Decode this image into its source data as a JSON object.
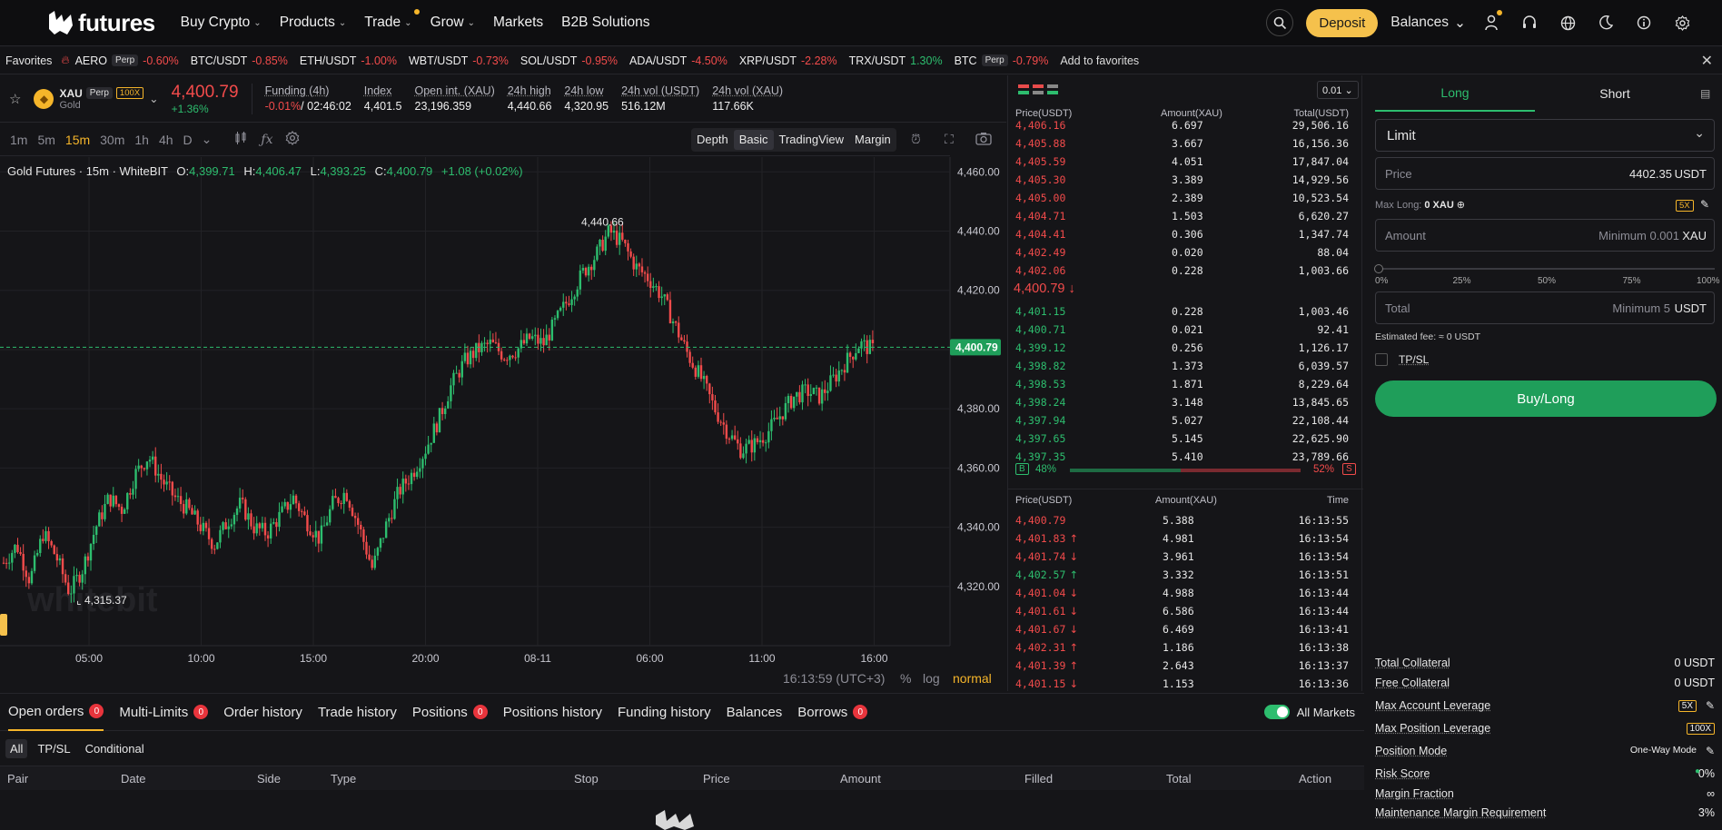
{
  "nav": {
    "logo_text": "futures",
    "menu": [
      {
        "label": "Buy Crypto",
        "chevron": true
      },
      {
        "label": "Products",
        "chevron": true
      },
      {
        "label": "Trade",
        "chevron": true
      },
      {
        "label": "Grow",
        "chevron": true
      },
      {
        "label": "Markets",
        "chevron": false
      },
      {
        "label": "B2B Solutions",
        "chevron": false
      }
    ],
    "deposit": "Deposit",
    "balances": "Balances"
  },
  "favorites": {
    "label": "Favorites",
    "items": [
      {
        "symbol": "AERO",
        "perp": "Perp",
        "change": "-0.60%",
        "up": false
      },
      {
        "symbol": "BTC/USDT",
        "perp": "",
        "change": "-0.85%",
        "up": false
      },
      {
        "symbol": "ETH/USDT",
        "perp": "",
        "change": "-1.00%",
        "up": false
      },
      {
        "symbol": "WBT/USDT",
        "perp": "",
        "change": "-0.73%",
        "up": false
      },
      {
        "symbol": "SOL/USDT",
        "perp": "",
        "change": "-0.95%",
        "up": false
      },
      {
        "symbol": "ADA/USDT",
        "perp": "",
        "change": "-4.50%",
        "up": false
      },
      {
        "symbol": "XRP/USDT",
        "perp": "",
        "change": "-2.28%",
        "up": false
      },
      {
        "symbol": "TRX/USDT",
        "perp": "",
        "change": "1.30%",
        "up": true
      },
      {
        "symbol": "BTC",
        "perp": "Perp",
        "change": "-0.79%",
        "up": false
      }
    ],
    "add": "Add to favorites"
  },
  "ticker": {
    "symbol": "XAU",
    "perp": "Perp",
    "leverage": "100X",
    "name": "Gold",
    "price": "4,400.79",
    "change": "+1.36%",
    "stats": [
      {
        "label": "Funding (4h)",
        "value": "-0.01%",
        "value2": "/ 02:46:02"
      },
      {
        "label": "Index",
        "value": "4,401.5"
      },
      {
        "label": "Open int. (XAU)",
        "value": "23,196.359"
      },
      {
        "label": "24h high",
        "value": "4,440.66"
      },
      {
        "label": "24h low",
        "value": "4,320.95"
      },
      {
        "label": "24h vol (USDT)",
        "value": "516.12M"
      },
      {
        "label": "24h vol (XAU)",
        "value": "117.66K"
      }
    ]
  },
  "chart_tools": {
    "timeframes": [
      "1m",
      "5m",
      "15m",
      "30m",
      "1h",
      "4h",
      "D"
    ],
    "active": "15m",
    "views": [
      "Depth",
      "Basic",
      "TradingView",
      "Margin"
    ],
    "active_view": "Basic"
  },
  "chart_data": {
    "type": "candlestick",
    "legend": {
      "title": "Gold Futures · 15m · WhiteBIT",
      "o": "4,399.71",
      "h": "4,406.47",
      "l": "4,393.25",
      "c": "4,400.79",
      "chg": "+1.08 (+0.02%)"
    },
    "y_ticks": [
      "4,460.00",
      "4,440.00",
      "4,420.00",
      "4,400.00",
      "4,380.00",
      "4,360.00",
      "4,340.00",
      "4,320.00"
    ],
    "y_tick_values": [
      4460,
      4440,
      4420,
      4400,
      4380,
      4360,
      4340,
      4320
    ],
    "x_ticks": [
      "05:00",
      "10:00",
      "15:00",
      "20:00",
      "08-11",
      "06:00",
      "11:00",
      "16:00"
    ],
    "last_price": "4,400.79",
    "last_value": 4400.79,
    "high_label": "4,440.66",
    "high_value": 4440.66,
    "low_label": "4,315.37",
    "low_value": 4315.37,
    "ylim": [
      4300,
      4465
    ],
    "watermark": "whitebit",
    "path": [
      4328,
      4334,
      4322,
      4338,
      4330,
      4318,
      4326,
      4340,
      4350,
      4346,
      4358,
      4364,
      4356,
      4350,
      4346,
      4340,
      4334,
      4342,
      4348,
      4340,
      4338,
      4344,
      4350,
      4342,
      4336,
      4348,
      4352,
      4340,
      4326,
      4340,
      4352,
      4358,
      4366,
      4376,
      4388,
      4396,
      4400,
      4402,
      4398,
      4400,
      4404,
      4402,
      4410,
      4418,
      4426,
      4432,
      4440,
      4436,
      4428,
      4424,
      4418,
      4408,
      4398,
      4390,
      4380,
      4372,
      4366,
      4368,
      4372,
      4378,
      4384,
      4386,
      4384,
      4390,
      4396,
      4402,
      4400
    ]
  },
  "chart_footer": {
    "time": "16:13:59 (UTC+3)",
    "pct": "%",
    "log": "log",
    "normal": "normal"
  },
  "orderbook": {
    "step": "0.01",
    "head": [
      "Price(USDT)",
      "Amount(XAU)",
      "Total(USDT)"
    ],
    "asks": [
      [
        "4,406.16",
        "6.697",
        "29,506.16"
      ],
      [
        "4,405.88",
        "3.667",
        "16,156.36"
      ],
      [
        "4,405.59",
        "4.051",
        "17,847.04"
      ],
      [
        "4,405.30",
        "3.389",
        "14,929.56"
      ],
      [
        "4,405.00",
        "2.389",
        "10,523.54"
      ],
      [
        "4,404.71",
        "1.503",
        "6,620.27"
      ],
      [
        "4,404.41",
        "0.306",
        "1,347.74"
      ],
      [
        "4,402.49",
        "0.020",
        "88.04"
      ],
      [
        "4,402.06",
        "0.228",
        "1,003.66"
      ]
    ],
    "mid": "4,400.79 ↓",
    "bids": [
      [
        "4,401.15",
        "0.228",
        "1,003.46"
      ],
      [
        "4,400.71",
        "0.021",
        "92.41"
      ],
      [
        "4,399.12",
        "0.256",
        "1,126.17"
      ],
      [
        "4,398.82",
        "1.373",
        "6,039.57"
      ],
      [
        "4,398.53",
        "1.871",
        "8,229.64"
      ],
      [
        "4,398.24",
        "3.148",
        "13,845.65"
      ],
      [
        "4,397.94",
        "5.027",
        "22,108.44"
      ],
      [
        "4,397.65",
        "5.145",
        "22,625.90"
      ],
      [
        "4,397.35",
        "5.410",
        "23,789.66"
      ]
    ],
    "buy_pct": "48%",
    "sell_pct": "52%",
    "buy_fraction": 0.48,
    "b": "B",
    "s": "S"
  },
  "trades": {
    "head": [
      "Price(USDT)",
      "Amount(XAU)",
      "Time"
    ],
    "rows": [
      [
        "4,400.79",
        "",
        "5.388",
        "16:13:55",
        false
      ],
      [
        "4,401.83",
        "↑",
        "4.981",
        "16:13:54",
        false
      ],
      [
        "4,401.74",
        "↓",
        "3.961",
        "16:13:54",
        false
      ],
      [
        "4,402.57",
        "↑",
        "3.332",
        "16:13:51",
        true
      ],
      [
        "4,401.04",
        "↓",
        "4.988",
        "16:13:44",
        false
      ],
      [
        "4,401.61",
        "↓",
        "6.586",
        "16:13:44",
        false
      ],
      [
        "4,401.67",
        "↓",
        "6.469",
        "16:13:41",
        false
      ],
      [
        "4,402.31",
        "↑",
        "1.186",
        "16:13:38",
        false
      ],
      [
        "4,401.39",
        "↑",
        "2.643",
        "16:13:37",
        false
      ],
      [
        "4,401.15",
        "↓",
        "1.153",
        "16:13:36",
        false
      ]
    ]
  },
  "bottom_tabs": [
    {
      "label": "Open orders",
      "badge": "0",
      "active": true
    },
    {
      "label": "Multi-Limits",
      "badge": "0"
    },
    {
      "label": "Order history",
      "badge": ""
    },
    {
      "label": "Trade history",
      "badge": ""
    },
    {
      "label": "Positions",
      "badge": "0"
    },
    {
      "label": "Positions history",
      "badge": ""
    },
    {
      "label": "Funding history",
      "badge": ""
    },
    {
      "label": "Balances",
      "badge": ""
    },
    {
      "label": "Borrows",
      "badge": "0"
    }
  ],
  "all_markets": "All Markets",
  "sub_tabs": [
    "All",
    "TP/SL",
    "Conditional"
  ],
  "columns": [
    "Pair",
    "Date",
    "Side",
    "Type",
    "Stop",
    "Price",
    "Amount",
    "Filled",
    "Total",
    "Action"
  ],
  "order_form": {
    "long": "Long",
    "short": "Short",
    "type": "Limit",
    "price_label": "Price",
    "price": "4402.35",
    "usdt": "USDT",
    "max_long": "Max Long:",
    "max_long_val": "0 XAU",
    "lev": "5X",
    "amount_label": "Amount",
    "amount_placeholder": "Minimum 0.001",
    "xau": "XAU",
    "slider": [
      "0%",
      "25%",
      "50%",
      "75%",
      "100%"
    ],
    "total_label": "Total",
    "total_placeholder": "Minimum 5",
    "fee": "Estimated fee: ≈ 0 USDT",
    "tpsl": "TP/SL",
    "submit": "Buy/Long"
  },
  "account": [
    {
      "label": "Total Collateral",
      "value": "0 USDT"
    },
    {
      "label": "Free Collateral",
      "value": "0 USDT"
    },
    {
      "label": "Max Account Leverage",
      "value": "5X"
    },
    {
      "label": "Max Position Leverage",
      "value": "100X"
    },
    {
      "label": "Position Mode",
      "value": "One-Way Mode"
    },
    {
      "label": "Risk Score",
      "value": "0%"
    },
    {
      "label": "Margin Fraction",
      "value": "∞"
    },
    {
      "label": "Maintenance Margin Requirement",
      "value": "3%"
    }
  ]
}
